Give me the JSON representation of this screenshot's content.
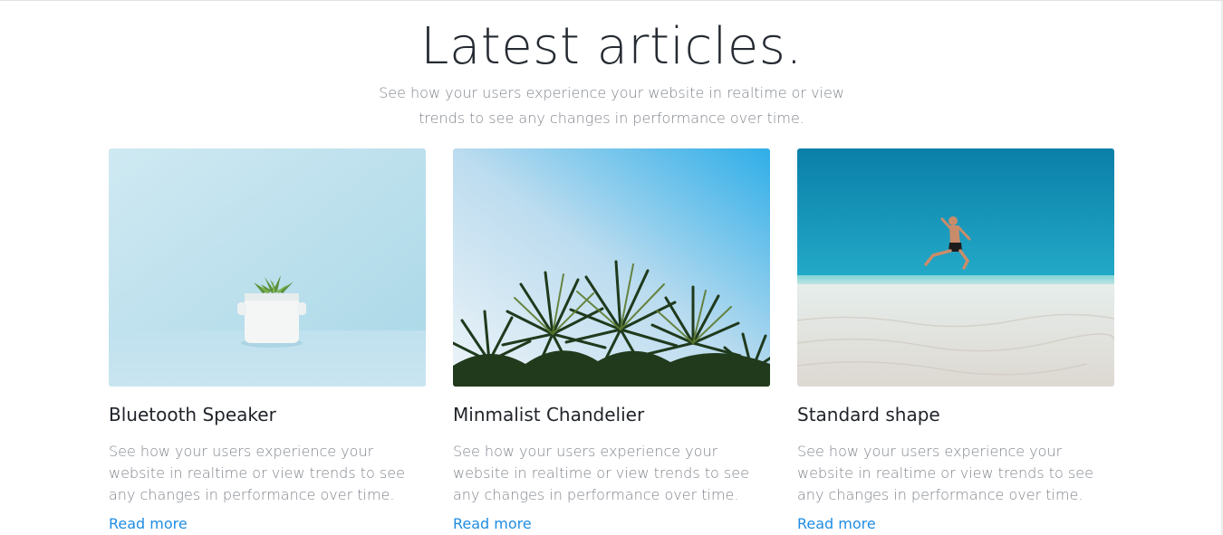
{
  "section": {
    "title": "Latest articles.",
    "subtitle": "See how your users experience your website in realtime or view trends to see any changes in performance over time."
  },
  "articles": [
    {
      "image": "succulent-pot-photo",
      "title": "Bluetooth Speaker",
      "excerpt": "See how your users experience your website in realtime or view trends to see any changes in performance over time.",
      "link_label": "Read more"
    },
    {
      "image": "palm-trees-sky-photo",
      "title": "Minmalist Chandelier",
      "excerpt": "See how your users experience your website in realtime or view trends to see any changes in performance over time.",
      "link_label": "Read more"
    },
    {
      "image": "beach-jumping-man-photo",
      "title": "Standard shape",
      "excerpt": "See how your users experience your website in realtime or view trends to see any changes in performance over time.",
      "link_label": "Read more"
    }
  ],
  "colors": {
    "title": "#262b33",
    "muted_text": "#80858d",
    "link": "#1f8ce3"
  }
}
